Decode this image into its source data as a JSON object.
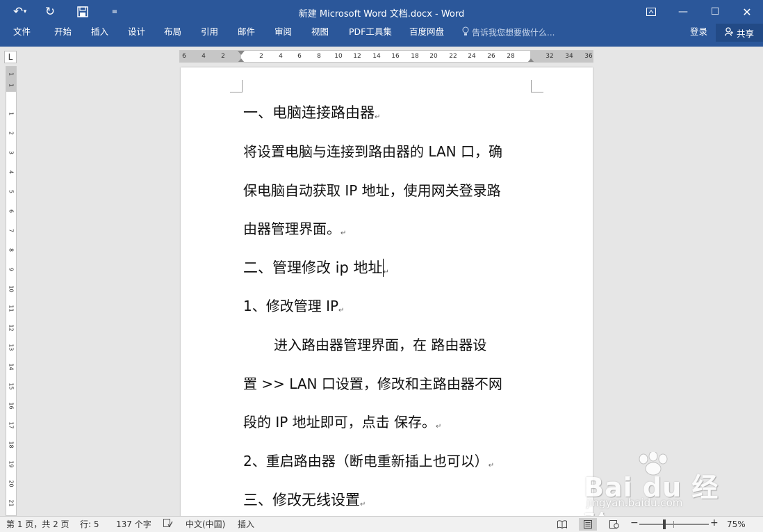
{
  "titlebar": {
    "title": "新建 Microsoft Word 文档.docx  -  Word",
    "undo_icon": "undo-icon",
    "redo_icon": "redo-icon",
    "save_icon": "save-icon",
    "customize_icon": "customize-qa-icon",
    "colors": {
      "bg": "#2b579a"
    }
  },
  "ribbon": {
    "tabs": [
      "文件",
      "开始",
      "插入",
      "设计",
      "布局",
      "引用",
      "邮件",
      "审阅",
      "视图",
      "PDF工具集",
      "百度网盘"
    ],
    "tell_me": "告诉我您想要做什么...",
    "login": "登录",
    "share": "共享"
  },
  "ruler": {
    "corner": "L",
    "ticks": [
      "6",
      "4",
      "2",
      "2",
      "4",
      "6",
      "8",
      "10",
      "12",
      "14",
      "16",
      "18",
      "20",
      "22",
      "24",
      "26",
      "28",
      "32",
      "34",
      "36"
    ],
    "v_ticks": [
      "1",
      "1",
      "1",
      "2",
      "3",
      "4",
      "5",
      "6",
      "7",
      "8",
      "9",
      "10",
      "11",
      "12",
      "13",
      "14",
      "15",
      "16",
      "17",
      "18",
      "19",
      "20",
      "21"
    ]
  },
  "document": {
    "paragraphs": [
      "一、电脑连接路由器",
      "将设置电脑与连接到路由器的 LAN 口，确",
      "保电脑自动获取 IP 地址，使用网关登录路",
      "由器管理界面。",
      "二、管理修改 ip 地址",
      "1、修改管理 IP",
      "进入路由器管理界面，在  路由器设",
      "置  >> LAN 口设置，修改和主路由器不网",
      "段的 IP 地址即可，点击  保存。",
      "2、重启路由器（断电重新插上也可以）",
      "三、修改无线设置"
    ],
    "para_mark": "↵"
  },
  "watermark": {
    "text": "Bai du 经验",
    "sub": "jingyan.baidu.com"
  },
  "statusbar": {
    "page": "第 1 页，共 2 页",
    "line": "行: 5",
    "words": "137 个字",
    "lang": "中文(中国)",
    "mode": "插入",
    "zoom": "75%",
    "zoom_minus": "−",
    "zoom_plus": "+"
  }
}
